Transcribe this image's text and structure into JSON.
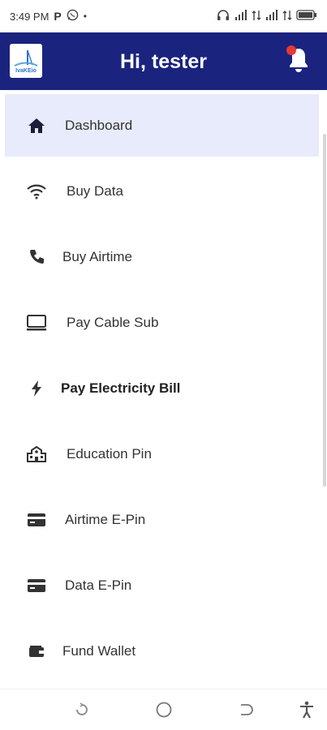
{
  "status_bar": {
    "time": "3:49 PM",
    "app_letter": "P",
    "dot": "•"
  },
  "header": {
    "title": "Hi, tester",
    "logo_text": "IvaKEio",
    "accent_color": "#1a237e",
    "badge_color": "#e53935"
  },
  "menu": {
    "items": [
      {
        "label": "Dashboard",
        "icon": "home-icon",
        "active": true
      },
      {
        "label": "Buy Data",
        "icon": "wifi-icon"
      },
      {
        "label": "Buy Airtime",
        "icon": "phone-icon"
      },
      {
        "label": "Pay Cable Sub",
        "icon": "tv-icon"
      },
      {
        "label": "Pay Electricity Bill",
        "icon": "bolt-icon"
      },
      {
        "label": "Education Pin",
        "icon": "school-icon"
      },
      {
        "label": "Airtime E-Pin",
        "icon": "card-icon"
      },
      {
        "label": "Data E-Pin",
        "icon": "card-icon"
      },
      {
        "label": "Fund Wallet",
        "icon": "wallet-icon"
      }
    ]
  },
  "nav_bar": {
    "buttons": [
      "recent-apps-icon",
      "home-circle-icon",
      "back-icon",
      "accessibility-icon"
    ]
  }
}
